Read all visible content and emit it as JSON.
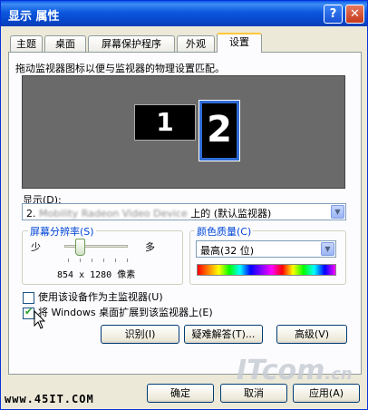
{
  "window": {
    "title": "显示 属性",
    "help_label": "?",
    "close_label": "✕"
  },
  "tabs": [
    {
      "label": "主题"
    },
    {
      "label": "桌面"
    },
    {
      "label": "屏幕保护程序"
    },
    {
      "label": "外观"
    },
    {
      "label": "设置",
      "active": true
    }
  ],
  "settings": {
    "instruction": "拖动监视器图标以便与监视器的物理设置匹配。",
    "monitors": [
      "1",
      "2"
    ],
    "display_label": "显示(D):",
    "display_value_prefix": "2. ",
    "display_value_blurred": "Mobility Radeon Video Device",
    "display_value_suffix": " 上的 (默认监视器)",
    "resolution": {
      "title": "屏幕分辨率(S)",
      "less": "少",
      "more": "多",
      "value_text": "854 x 1280 像素",
      "slider_position": 0.2
    },
    "color": {
      "title": "颜色质量(C)",
      "value": "最高(32 位)"
    },
    "checkboxes": [
      {
        "label": "使用该设备作为主监视器(U)",
        "checked": false
      },
      {
        "label": "将 Windows 桌面扩展到该监视器上(E)",
        "checked": true
      }
    ],
    "buttons": {
      "identify": "识别(I)",
      "troubleshoot": "疑难解答(T)...",
      "advanced": "高级(V)"
    }
  },
  "footer": {
    "ok": "确定",
    "cancel": "取消",
    "apply": "应用(A)"
  },
  "watermarks": {
    "site": "www.45IT.COM",
    "logo": "ITcom",
    "logo_sub": ".cn"
  },
  "colors": {
    "title_bar": "#0a58de",
    "group_title": "#0046d5",
    "monitor_bg": "#6a6a6a",
    "selected_monitor_border": "#2f6dd6"
  }
}
